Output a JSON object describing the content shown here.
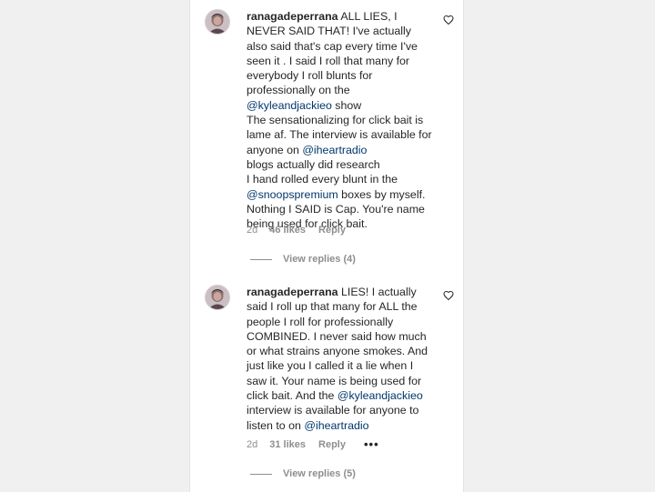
{
  "comments": [
    {
      "username": "ranagadeperrana",
      "paragraphs": [
        [
          {
            "t": " ALL LIES, I NEVER SAID THAT! I've actually also said that's cap every time I've seen it . I said I roll that many for everybody I roll blunts for professionally on the "
          },
          {
            "t": "@kyleandjackieo",
            "m": true
          },
          {
            "t": " show"
          }
        ],
        [
          {
            "t": "The sensationalizing for click bait is lame af. The interview is available for anyone on "
          },
          {
            "t": "@iheartradio",
            "m": true
          }
        ],
        [
          {
            "t": "blogs actually did research"
          }
        ],
        [
          {
            "t": "I hand rolled every blunt in the "
          },
          {
            "t": "@snoopspremium",
            "m": true
          },
          {
            "t": " boxes by myself. Nothing I SAID is Cap. You're name being used for click bait."
          }
        ]
      ],
      "time": "2d",
      "likes": "46 likes",
      "reply_label": "Reply",
      "more": "",
      "view_replies": "View replies (4)"
    },
    {
      "username": "ranagadeperrana",
      "paragraphs": [
        [
          {
            "t": " LIES! I actually said I roll up that many for ALL the people I roll for professionally COMBINED. I never said how much or what strains anyone smokes. And just like you I called it a lie when I saw it. Your name is being used for click bait. And the "
          },
          {
            "t": "@kyleandjackieo",
            "m": true
          },
          {
            "t": " interview is available for anyone to listen to on "
          },
          {
            "t": "@iheartradio",
            "m": true
          }
        ]
      ],
      "time": "2d",
      "likes": "31 likes",
      "reply_label": "Reply",
      "more": "•••",
      "view_replies": "View replies (5)"
    }
  ],
  "icons": {
    "heart": "heart-outline-icon",
    "avatar": "user-avatar"
  },
  "colors": {
    "text": "#262626",
    "secondary": "#8e8e8e",
    "mention": "#00376b"
  }
}
